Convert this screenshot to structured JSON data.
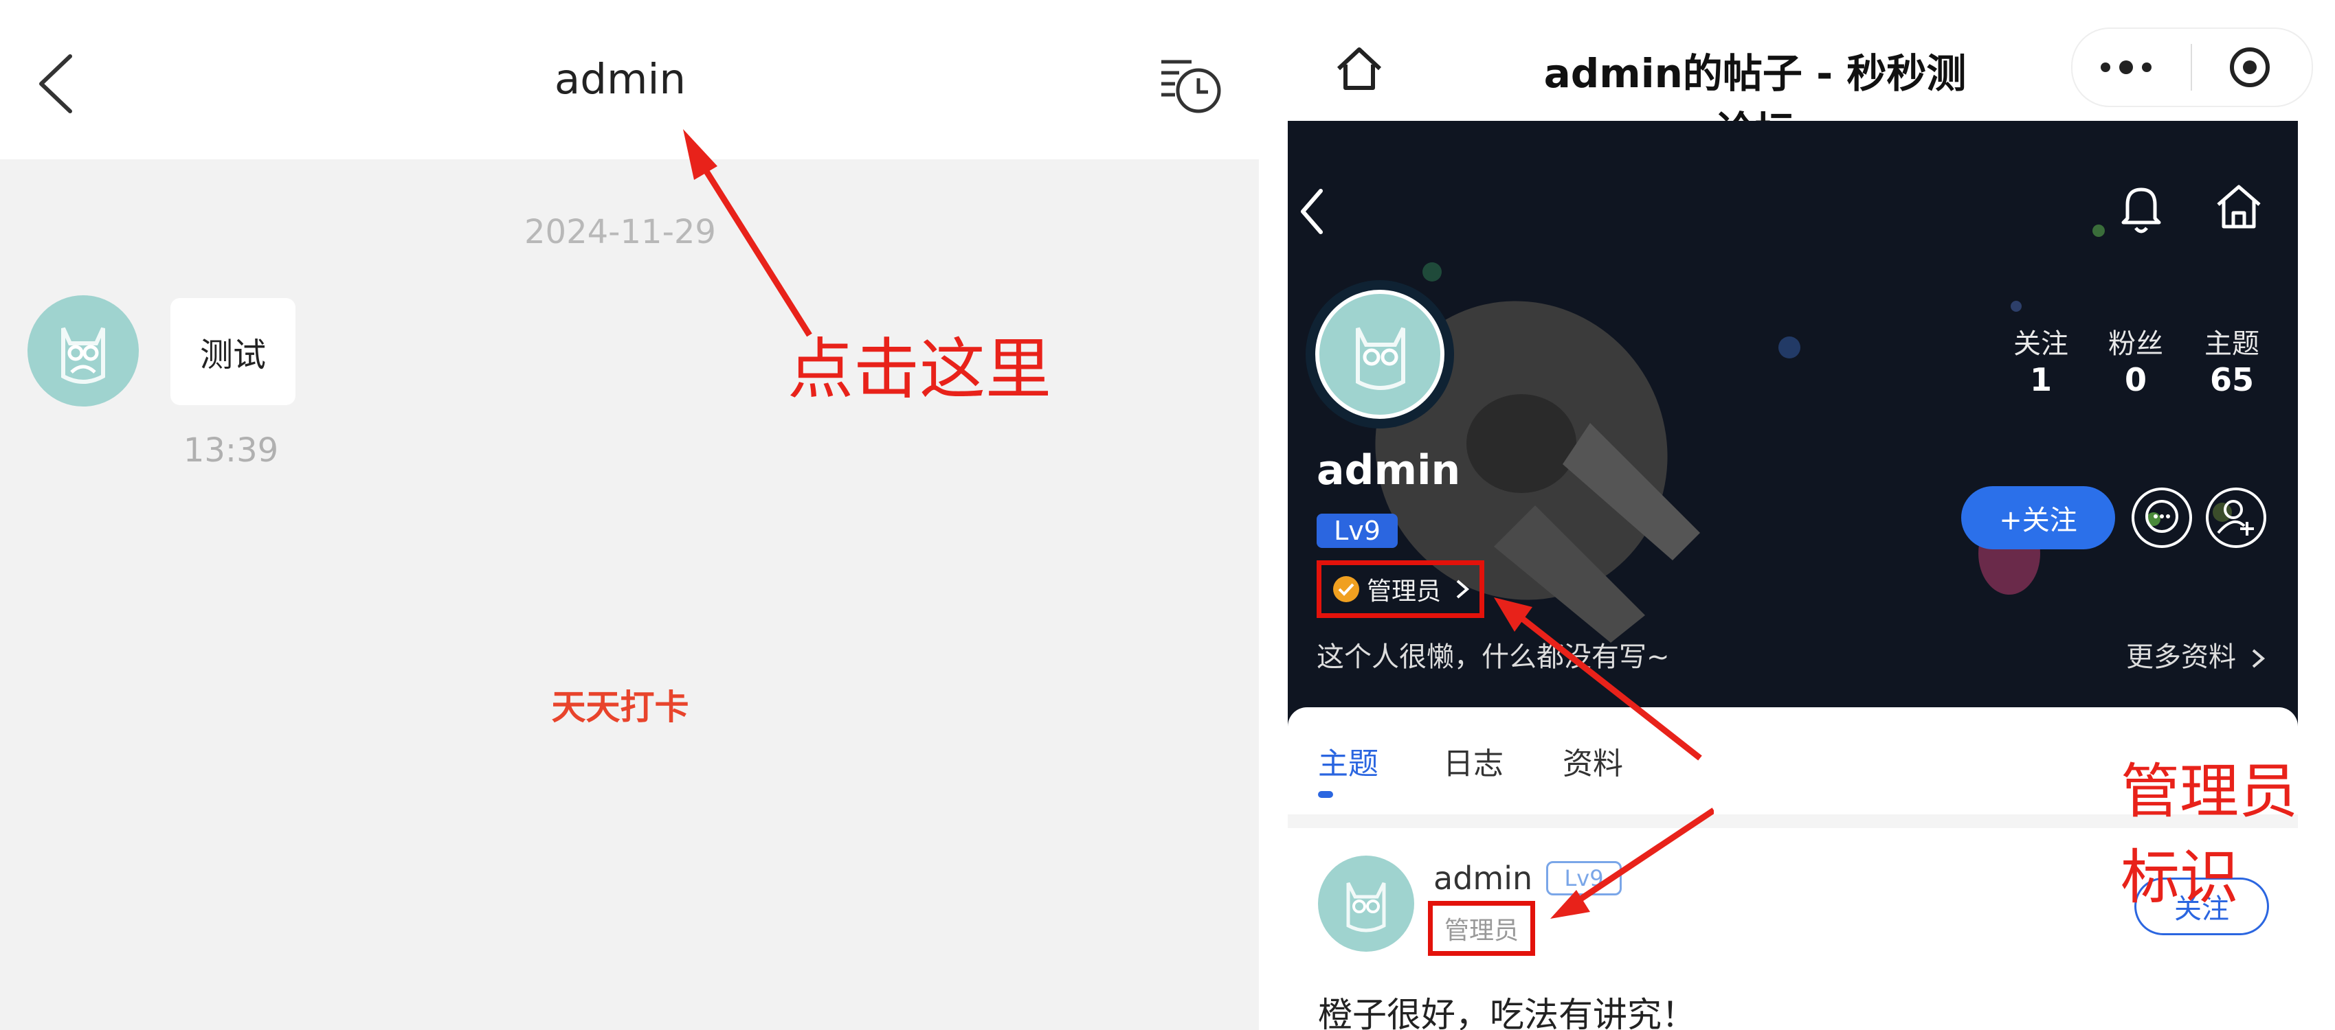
{
  "left_chat": {
    "title": "admin",
    "date": "2024-11-29",
    "message": "测试",
    "time": "13:39",
    "checkin": "天天打卡",
    "annotation": "点击这里"
  },
  "right_profile": {
    "page_title": "admin的帖子 - 秒秒测论坛",
    "stats": [
      {
        "label": "关注",
        "value": "1"
      },
      {
        "label": "粉丝",
        "value": "0"
      },
      {
        "label": "主题",
        "value": "65"
      }
    ],
    "username": "admin",
    "level": "Lv9",
    "admin_badge": "管理员",
    "follow_button": "+关注",
    "bio": "这个人很懒，什么都没有写~",
    "more_info": "更多资料",
    "tabs": [
      "主题",
      "日志",
      "资料"
    ],
    "annotation": "管理员标识",
    "post": {
      "author": "admin",
      "level": "Lv9",
      "role": "管理员",
      "follow": "关注",
      "text": "橙子很好，吃法有讲究！"
    }
  },
  "colors": {
    "annotation": "#e8221a",
    "accent_blue": "#2b66e0",
    "hero_bg": "#0f1521",
    "avatar": "#9fd3cf"
  }
}
